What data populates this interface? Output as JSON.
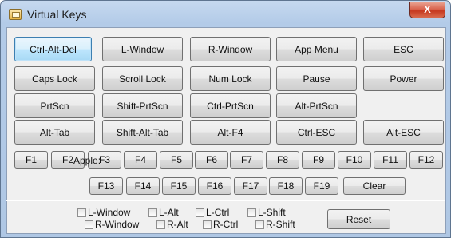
{
  "window": {
    "title": "Virtual Keys",
    "close_symbol": "X"
  },
  "keys": {
    "row1": [
      "Ctrl-Alt-Del",
      "L-Window",
      "R-Window",
      "App Menu",
      "ESC"
    ],
    "row2": [
      "Caps Lock",
      "Scroll Lock",
      "Num Lock",
      "Pause",
      "Power"
    ],
    "row3": [
      "PrtScn",
      "Shift-PrtScn",
      "Ctrl-PrtScn",
      "Alt-PrtScn"
    ],
    "row4": [
      "Alt-Tab",
      "Shift-Alt-Tab",
      "Alt-F4",
      "Ctrl-ESC",
      "Alt-ESC"
    ]
  },
  "function_keys": [
    "F1",
    "F2",
    "F3",
    "F4",
    "F5",
    "F6",
    "F7",
    "F8",
    "F9",
    "F10",
    "F11",
    "F12"
  ],
  "apple": {
    "label": "Apple:",
    "keys": [
      "F13",
      "F14",
      "F15",
      "F16",
      "F17",
      "F18",
      "F19"
    ],
    "clear": "Clear"
  },
  "modifiers": {
    "row1": [
      "L-Window",
      "L-Alt",
      "L-Ctrl",
      "L-Shift"
    ],
    "row2": [
      "R-Window",
      "R-Alt",
      "R-Ctrl",
      "R-Shift"
    ]
  },
  "reset_label": "Reset"
}
